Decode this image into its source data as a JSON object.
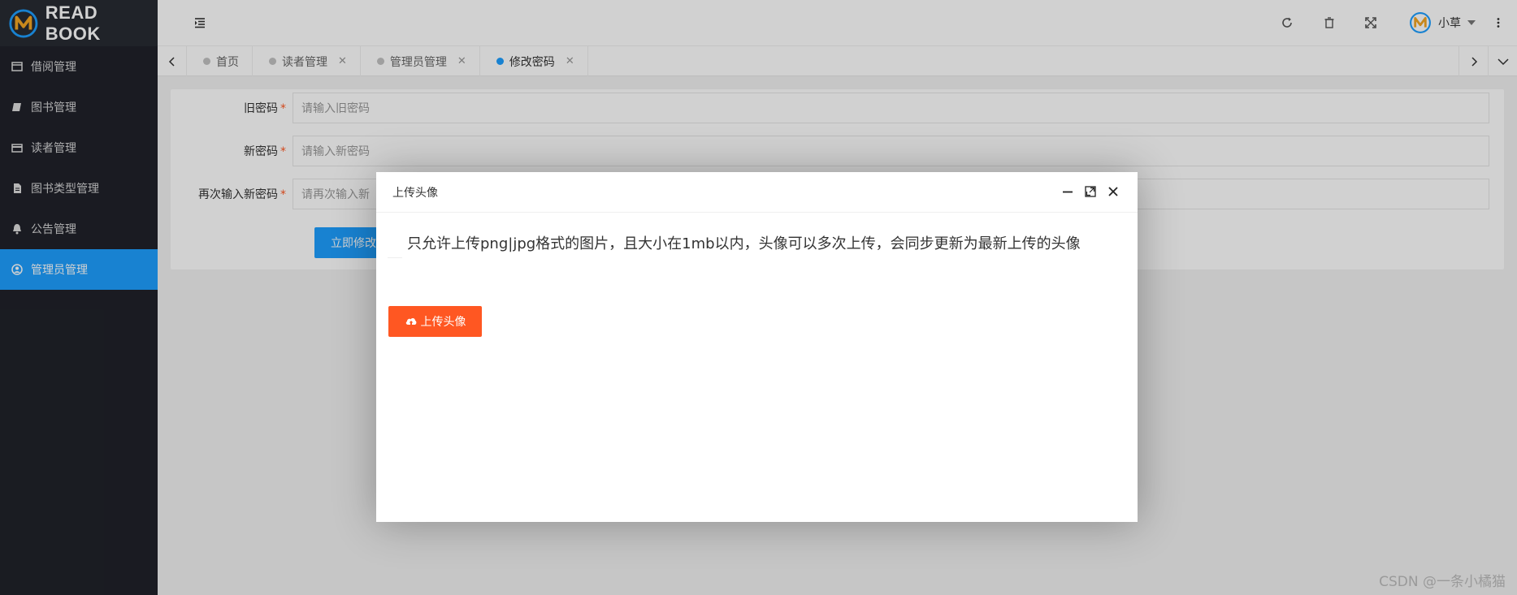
{
  "brand": {
    "name": "READ BOOK"
  },
  "sidebar": {
    "items": [
      {
        "label": "借阅管理",
        "icon": "window-icon"
      },
      {
        "label": "图书管理",
        "icon": "book-icon"
      },
      {
        "label": "读者管理",
        "icon": "card-icon"
      },
      {
        "label": "图书类型管理",
        "icon": "file-icon"
      },
      {
        "label": "公告管理",
        "icon": "bell-icon"
      },
      {
        "label": "管理员管理",
        "icon": "user-circle-icon",
        "active": true
      }
    ]
  },
  "header": {
    "user_name": "小草"
  },
  "tabs": [
    {
      "label": "首页",
      "closable": false
    },
    {
      "label": "读者管理",
      "closable": true
    },
    {
      "label": "管理员管理",
      "closable": true
    },
    {
      "label": "修改密码",
      "closable": true,
      "active": true
    }
  ],
  "form": {
    "old_password": {
      "label": "旧密码",
      "placeholder": "请输入旧密码"
    },
    "new_password": {
      "label": "新密码",
      "placeholder": "请输入新密码"
    },
    "confirm_password": {
      "label": "再次输入新密码",
      "placeholder": "请再次输入新"
    },
    "submit_label": "立即修改",
    "required_mark": "*"
  },
  "modal": {
    "title": "上传头像",
    "notice": "只允许上传png|jpg格式的图片，且大小在1mb以内，头像可以多次上传，会同步更新为最新上传的头像",
    "upload_label": "上传头像"
  },
  "watermark": "CSDN @一条小橘猫",
  "colors": {
    "primary": "#1e9fff",
    "danger": "#ff5722",
    "sidebar": "#20222a"
  }
}
